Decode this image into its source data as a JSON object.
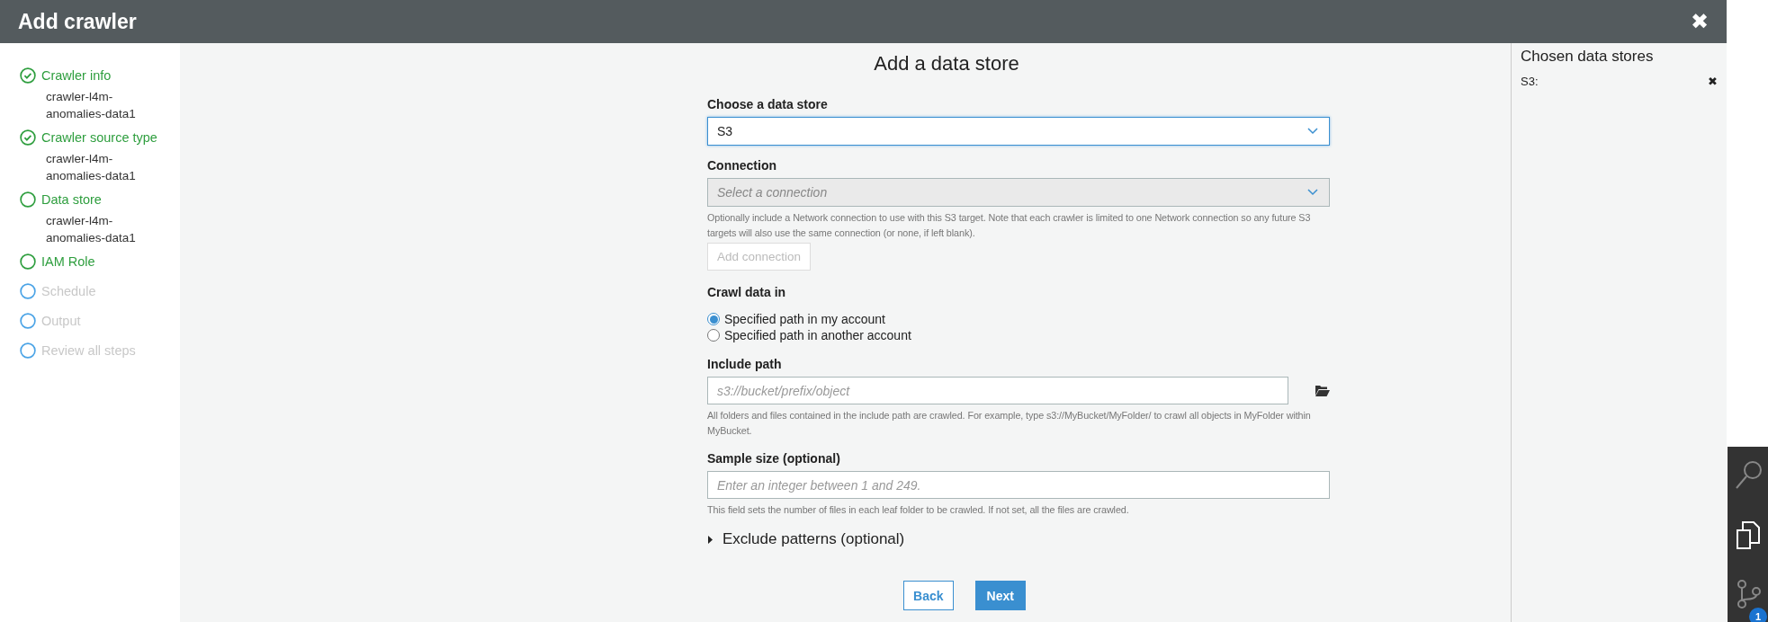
{
  "window": {
    "title": "Add crawler",
    "close": "✖"
  },
  "steps": [
    {
      "label": "Crawler info",
      "completed": true,
      "enabled": true,
      "detail": "crawler-l4m-anomalies-data1"
    },
    {
      "label": "Crawler source type",
      "completed": true,
      "enabled": true,
      "detail": "crawler-l4m-anomalies-data1"
    },
    {
      "label": "Data store",
      "completed": false,
      "enabled": true,
      "detail": "crawler-l4m-anomalies-data1"
    },
    {
      "label": "IAM Role",
      "completed": false,
      "enabled": true
    },
    {
      "label": "Schedule",
      "completed": false,
      "enabled": false
    },
    {
      "label": "Output",
      "completed": false,
      "enabled": false
    },
    {
      "label": "Review all steps",
      "completed": false,
      "enabled": false
    }
  ],
  "form": {
    "title": "Add a data store",
    "data_store": {
      "label": "Choose a data store",
      "value": "S3"
    },
    "connection": {
      "label": "Connection",
      "placeholder": "Select a connection",
      "disabled": true,
      "help": "Optionally include a Network connection to use with this S3 target. Note that each crawler is limited to one Network connection so any future S3 targets will also use the same connection (or none, if left blank).",
      "add_button": "Add connection"
    },
    "crawl_data_in": {
      "label": "Crawl data in",
      "options": [
        {
          "label": "Specified path in my account",
          "selected": true
        },
        {
          "label": "Specified path in another account",
          "selected": false
        }
      ]
    },
    "include_path": {
      "label": "Include path",
      "placeholder": "s3://bucket/prefix/object",
      "help": "All folders and files contained in the include path are crawled. For example, type s3://MyBucket/MyFolder/ to crawl all objects in MyFolder within MyBucket."
    },
    "sample_size": {
      "label": "Sample size (optional)",
      "placeholder": "Enter an integer between 1 and 249.",
      "help": "This field sets the number of files in each leaf folder to be crawled. If not set, all the files are crawled."
    },
    "exclude_patterns": {
      "label": "Exclude patterns (optional)",
      "expanded": false
    },
    "buttons": [
      {
        "label": "Back",
        "kind": "secondary"
      },
      {
        "label": "Next",
        "kind": "primary"
      }
    ]
  },
  "chosen": {
    "title": "Chosen data stores",
    "items": [
      {
        "label": "S3:",
        "remove": "✖"
      }
    ]
  },
  "dock": {
    "badge": "1"
  }
}
